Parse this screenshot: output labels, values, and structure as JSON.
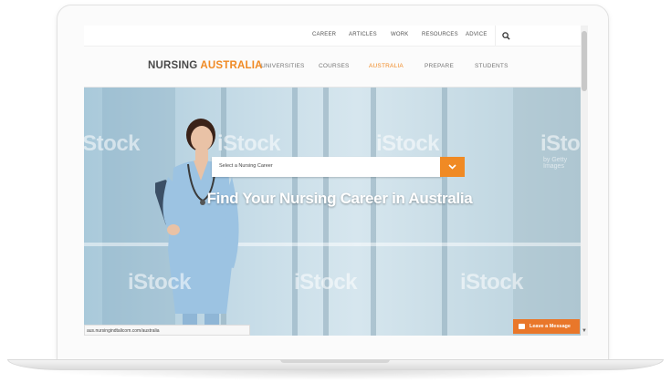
{
  "top_nav": [
    "CAREER",
    "ARTICLES",
    "WORK",
    "RESOURCES",
    "ADVICE"
  ],
  "logo": {
    "part1": "NURSING",
    "part2": "AUSTRALIA"
  },
  "main_nav": [
    "UNIVERSITIES",
    "COURSES",
    "AUSTRALIA",
    "PREPARE",
    "STUDENTS"
  ],
  "active_nav": "AUSTRALIA",
  "hero": {
    "title": "Find Your Nursing Career in Australia",
    "select_placeholder": "Select a Nursing Career"
  },
  "watermarks": [
    "iStock",
    "iStock",
    "iStock",
    "iStock",
    "iStock",
    "iStock",
    "iStock"
  ],
  "watermark_sub": "by Getty Images",
  "status_url": "aus.nursingindtalicom.com/australia",
  "leave_message": "Leave a Message",
  "colors": {
    "accent": "#f08a24",
    "logo_dark": "#4a4a4a"
  },
  "icons": [
    "search-icon",
    "chevron-down-icon",
    "chat-icon"
  ]
}
